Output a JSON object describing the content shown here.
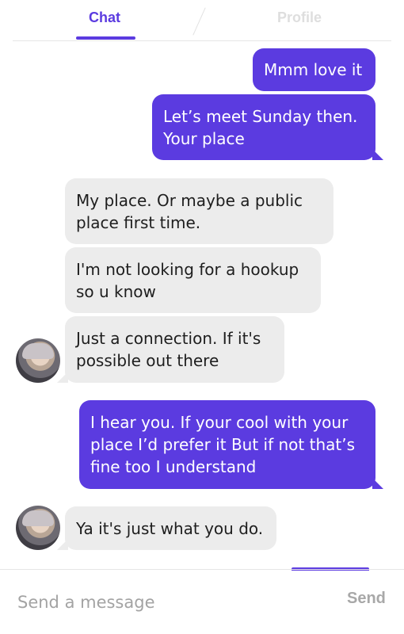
{
  "tabs": {
    "chat": "Chat",
    "profile": "Profile"
  },
  "messages": [
    {
      "text": "Mmm love it",
      "from": "me"
    },
    {
      "text": "Let’s meet Sunday then. Your place",
      "from": "me"
    },
    {
      "text": "My place.  Or maybe a public place first time.",
      "from": "them"
    },
    {
      "text": "I'm not looking for a hookup so u know",
      "from": "them"
    },
    {
      "text": "Just a connection. If it's possible out there",
      "from": "them"
    },
    {
      "text": "I hear you. If your cool with your place I’d prefer it But if not that’s fine too I understand",
      "from": "me"
    },
    {
      "text": "Ya it's just what you do.",
      "from": "them"
    }
  ],
  "composer": {
    "placeholder": "Send a message",
    "send_label": "Send"
  },
  "colors": {
    "accent": "#5b3be0",
    "incoming_bg": "#ececec"
  }
}
